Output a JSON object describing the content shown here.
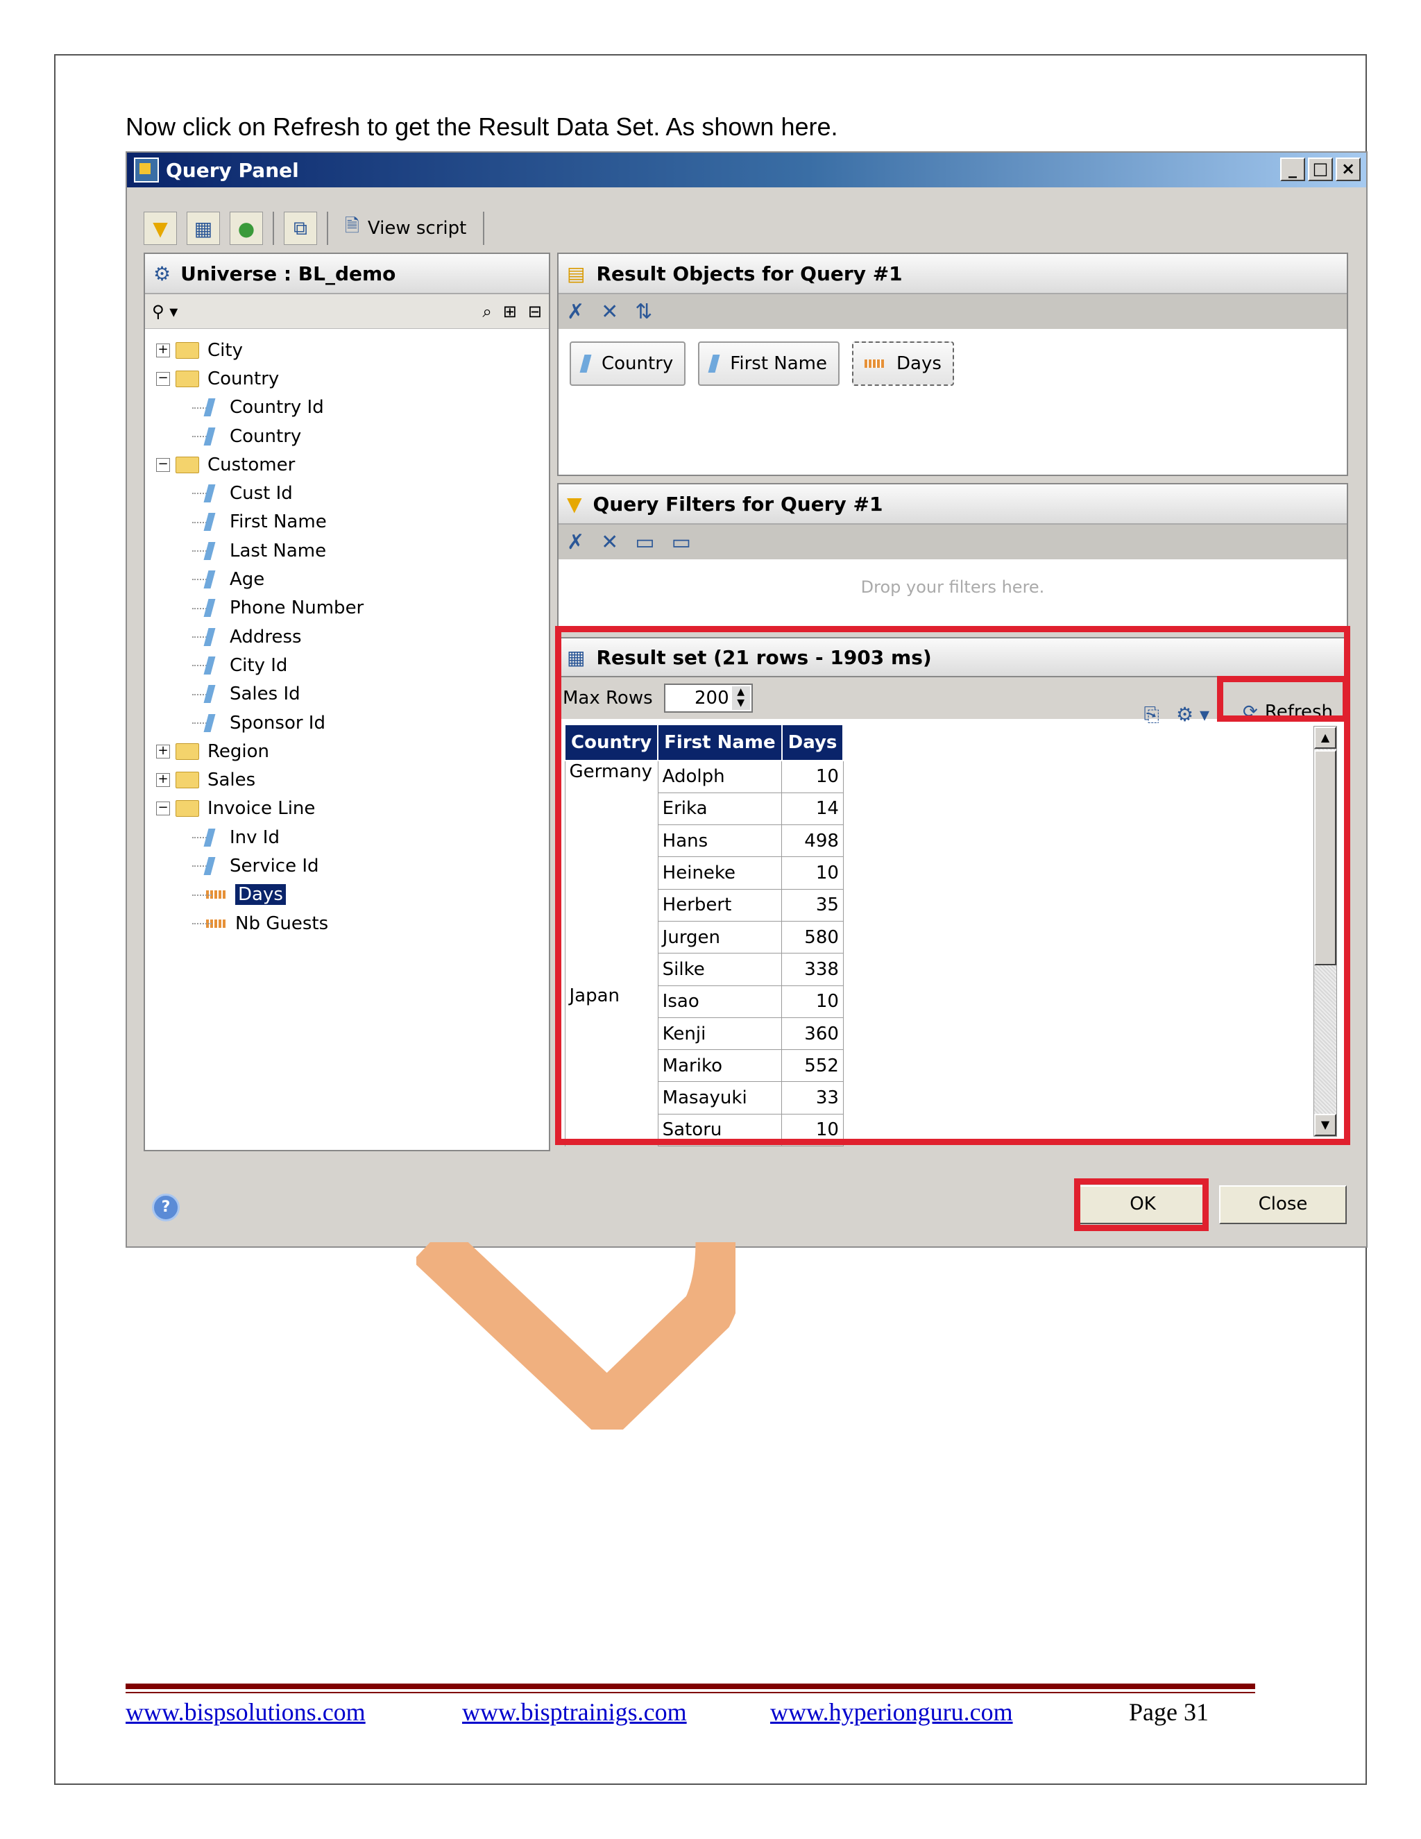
{
  "intro_text": "Now click on Refresh to get the Result Data Set. As shown here.",
  "dialog": {
    "title": "Query Panel",
    "window_buttons": [
      "_",
      "□",
      "×"
    ],
    "toolbar": {
      "view_script": "View script"
    },
    "universe_header": "Universe : BL_demo",
    "tree": [
      {
        "label": "City",
        "type": "folder",
        "expander": "+"
      },
      {
        "label": "Country",
        "type": "folder",
        "expander": "−"
      },
      {
        "label": "Country Id",
        "type": "dimension"
      },
      {
        "label": "Country",
        "type": "dimension"
      },
      {
        "label": "Customer",
        "type": "folder",
        "expander": "−"
      },
      {
        "label": "Cust Id",
        "type": "dimension"
      },
      {
        "label": "First Name",
        "type": "dimension"
      },
      {
        "label": "Last Name",
        "type": "dimension"
      },
      {
        "label": "Age",
        "type": "dimension"
      },
      {
        "label": "Phone Number",
        "type": "dimension"
      },
      {
        "label": "Address",
        "type": "dimension"
      },
      {
        "label": "City Id",
        "type": "dimension"
      },
      {
        "label": "Sales Id",
        "type": "dimension"
      },
      {
        "label": "Sponsor Id",
        "type": "dimension"
      },
      {
        "label": "Region",
        "type": "folder",
        "expander": "+"
      },
      {
        "label": "Sales",
        "type": "folder",
        "expander": "+"
      },
      {
        "label": "Invoice Line",
        "type": "folder",
        "expander": "−"
      },
      {
        "label": "Inv Id",
        "type": "dimension"
      },
      {
        "label": "Service Id",
        "type": "dimension"
      },
      {
        "label": "Days",
        "type": "measure",
        "selected": true
      },
      {
        "label": "Nb Guests",
        "type": "measure"
      }
    ],
    "result_objects_header": "Result Objects for Query #1",
    "result_objects": [
      "Country",
      "First Name",
      "Days"
    ],
    "query_filters_header": "Query Filters for Query #1",
    "filters_placeholder": "Drop your filters here.",
    "result_set_header": "Result set (21 rows - 1903 ms)",
    "max_rows_label": "Max Rows",
    "max_rows_value": "200",
    "refresh_label": "Refresh",
    "columns": [
      "Country",
      "First Name",
      "Days"
    ],
    "rows": [
      {
        "country": "Germany",
        "first_name": "Adolph",
        "days": "10"
      },
      {
        "country": "",
        "first_name": "Erika",
        "days": "14"
      },
      {
        "country": "",
        "first_name": "Hans",
        "days": "498"
      },
      {
        "country": "",
        "first_name": "Heineke",
        "days": "10"
      },
      {
        "country": "",
        "first_name": "Herbert",
        "days": "35"
      },
      {
        "country": "",
        "first_name": "Jurgen",
        "days": "580"
      },
      {
        "country": "",
        "first_name": "Silke",
        "days": "338"
      },
      {
        "country": "Japan",
        "first_name": "Isao",
        "days": "10"
      },
      {
        "country": "",
        "first_name": "Kenji",
        "days": "360"
      },
      {
        "country": "",
        "first_name": "Mariko",
        "days": "552"
      },
      {
        "country": "",
        "first_name": "Masayuki",
        "days": "33"
      },
      {
        "country": "",
        "first_name": "Satoru",
        "days": "10"
      }
    ],
    "ok_label": "OK",
    "close_label": "Close",
    "help_icon": "?"
  },
  "footer": {
    "links": [
      "www.bispsolutions.com",
      "www.bisptrainigs.com",
      "www.hyperionguru.com"
    ],
    "page": "Page 31"
  },
  "colors": {
    "highlight_red": "#e0202e",
    "header_navy": "#0a246a",
    "footer_rule": "#7f0000",
    "watermark": "#f0b07f"
  }
}
